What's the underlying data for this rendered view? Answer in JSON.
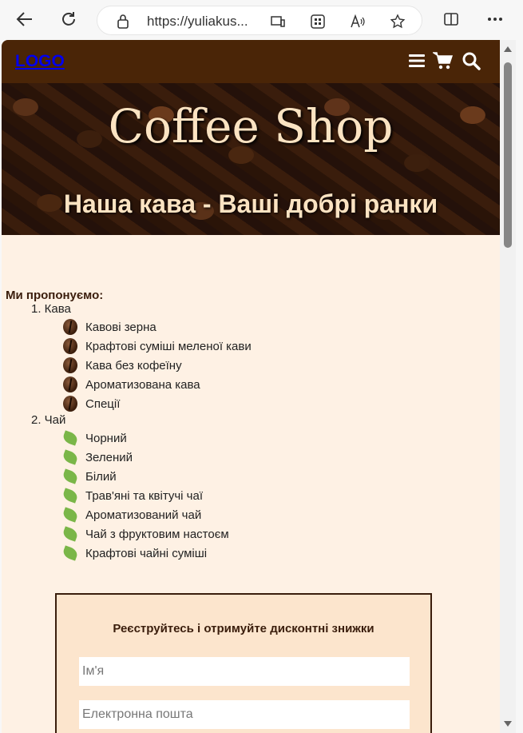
{
  "browser": {
    "url": "https://yuliakus..."
  },
  "site": {
    "logo": "LOGO",
    "hero_title": "Coffee Shop",
    "hero_subtitle": "Наша кава - Ваші добрі ранки"
  },
  "offer": {
    "title": "Ми пропонуємо:",
    "categories": [
      {
        "label": "1. Кава",
        "icon": "coffee-bean-icon",
        "items": [
          "Кавові зерна",
          "Крафтові суміші меленої кави",
          "Кава без кофеїну",
          "Ароматизована кава",
          "Спеції"
        ]
      },
      {
        "label": "2. Чай",
        "icon": "tea-leaf-icon",
        "items": [
          "Чорний",
          "Зелений",
          "Білий",
          "Трав'яні та квітучі чаї",
          "Ароматизований чай",
          "Чай з фруктовим настоєм",
          "Крафтові чайні суміші"
        ]
      }
    ]
  },
  "signup": {
    "title": "Реєструйтесь і отримуйте дисконтні знижки",
    "name_placeholder": "Ім'я",
    "email_placeholder": "Електронна пошта"
  },
  "colors": {
    "header_bg": "#4a2507",
    "page_bg": "#fef1e4",
    "form_bg": "#fce5cd",
    "hero_text": "#fbe3c2"
  }
}
